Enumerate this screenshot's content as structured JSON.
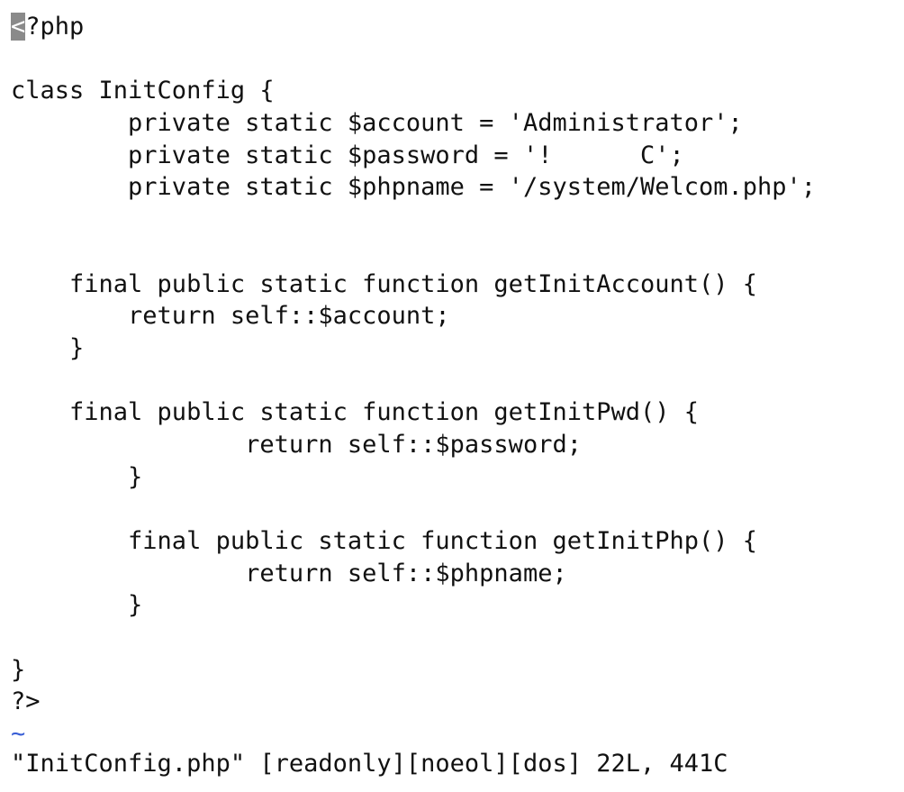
{
  "editor": {
    "cursor_char": "<",
    "lines": [
      "?php",
      "",
      "class InitConfig {",
      "        private static $account = 'Administrator';",
      "        private static $password = '!      C';",
      "        private static $phpname = '/system/Welcom.php';",
      "",
      "",
      "    final public static function getInitAccount() {",
      "        return self::$account;",
      "    }",
      "",
      "    final public static function getInitPwd() {",
      "                return self::$password;",
      "        }",
      "",
      "        final public static function getInitPhp() {",
      "                return self::$phpname;",
      "        }",
      "",
      "}",
      "?>"
    ],
    "tilde": "~",
    "status_line": "\"InitConfig.php\" [readonly][noeol][dos] 22L, 441C"
  },
  "colors": {
    "background": "#ffffff",
    "text": "#111111",
    "cursor": "#8a8a8a",
    "tilde": "#3a5fd6"
  }
}
